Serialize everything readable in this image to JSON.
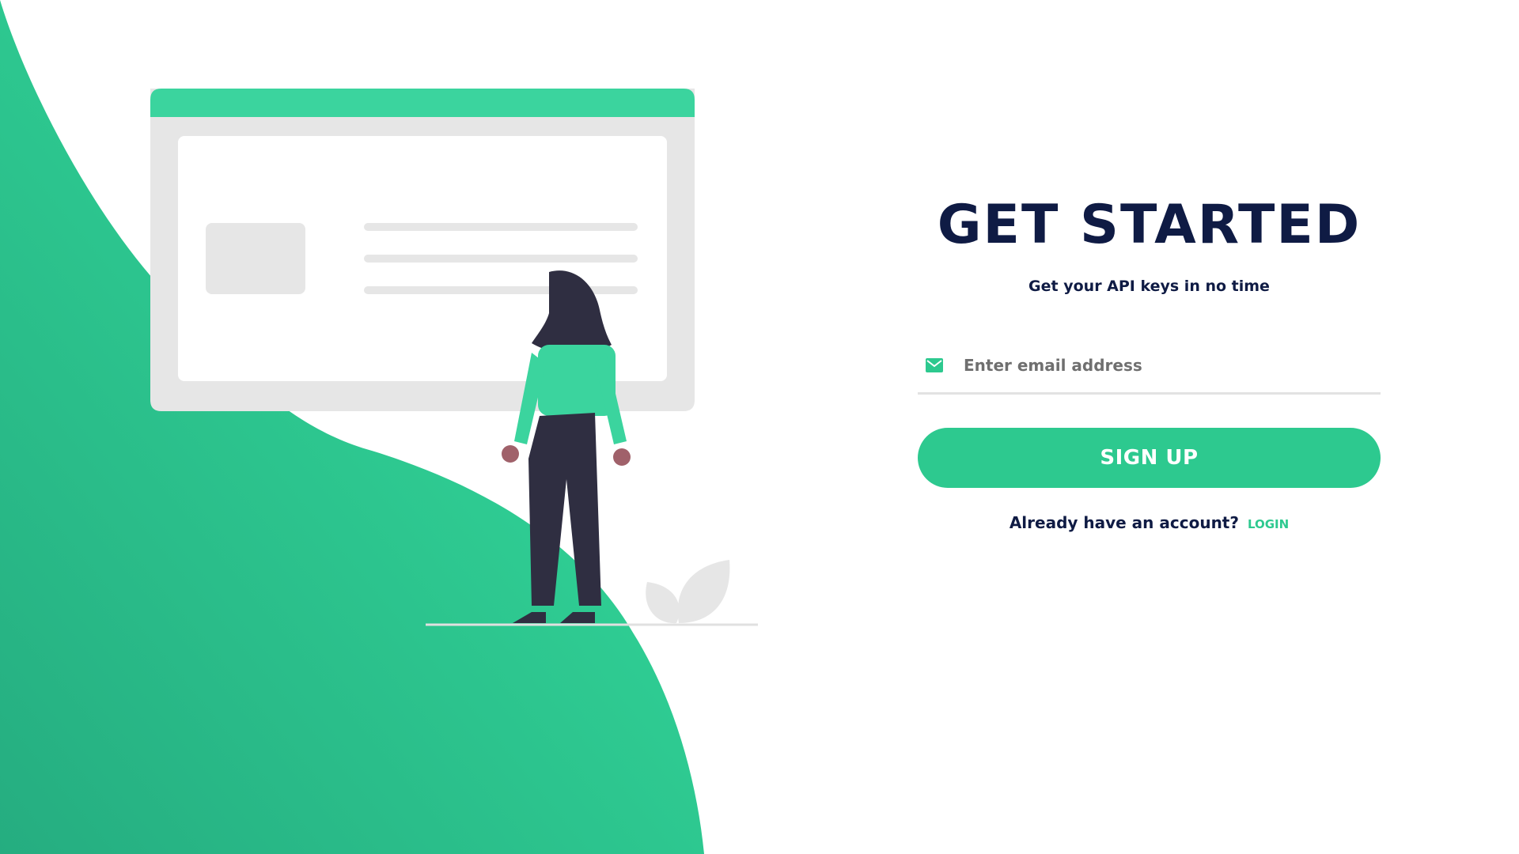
{
  "colors": {
    "accent": "#2dc98f",
    "title": "#0f1b44",
    "illustration_gray": "#e6e6e6",
    "figure_dark": "#2f2e41",
    "skin": "#a0616a"
  },
  "hero": {
    "title": "GET STARTED",
    "subtitle": "Get your API keys in no time"
  },
  "form": {
    "email_icon": "mail-icon",
    "email_placeholder": "Enter email address",
    "email_value": "",
    "signup_label": "SIGN UP"
  },
  "footer": {
    "account_prompt": "Already have an account?",
    "login_label": "LOGIN"
  }
}
